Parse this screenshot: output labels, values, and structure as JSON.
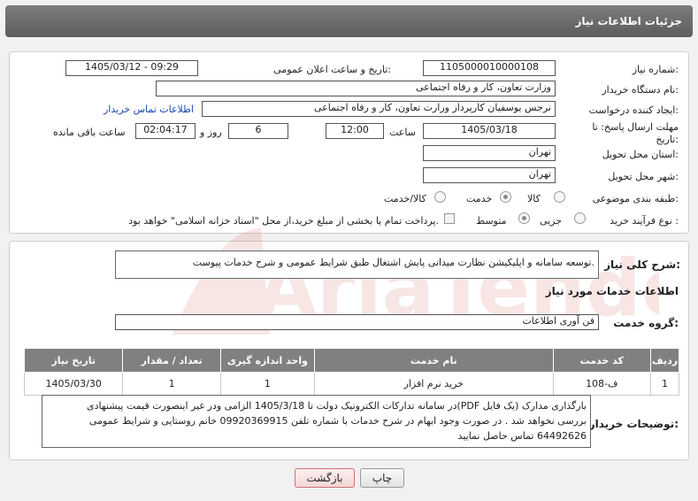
{
  "header": {
    "title": "جزئیات اطلاعات نیاز"
  },
  "form": {
    "need_number_label": "شماره نیاز:",
    "need_number": "1105000010000108",
    "announce_label": "تاریخ و ساعت اعلان عمومی:",
    "announce_value": "1405/03/12 - 09:29",
    "buyer_label": "نام دستگاه خریدار:",
    "buyer_value": "وزارت تعاون، کار و رفاه اجتماعی",
    "creator_label": "ایجاد کننده درخواست:",
    "creator_value": "نرجس یوسفیان کارپرداز وزارت تعاون، کار و رفاه اجتماعی",
    "contact_link": "اطلاعات تماس خریدار",
    "deadline_label": "مهلت ارسال پاسخ: تا تاریخ:",
    "deadline_date": "1405/03/18",
    "time_label": "ساعت",
    "deadline_time": "12:00",
    "days_value": "6",
    "days_label": "روز و",
    "remaining_time": "02:04:17",
    "remaining_label": "ساعت باقی مانده",
    "province_label": "استان محل تحویل:",
    "province_value": "تهران",
    "city_label": "شهر محل تحویل:",
    "city_value": "تهران",
    "category_label": "طبقه بندی موضوعی:",
    "category_options": [
      "کالا",
      "خدمت",
      "کالا/خدمت"
    ],
    "category_selected_index": 1,
    "process_label": "نوع فرآیند خرید :",
    "process_options": [
      "جزیی",
      "متوسط"
    ],
    "process_selected_index": 0,
    "payment_note": "پرداخت تمام یا بخشی از مبلغ خرید،از محل \"اسناد خزانه اسلامی\" خواهد بود."
  },
  "summary": {
    "label": "شرح کلی نیاز:",
    "value": "توسعه سامانه و اپلیکیشن نظارت میدانی پایش اشتغال طبق شرایط عمومی و شرح خدمات پیوست."
  },
  "services": {
    "section_title": "اطلاعات خدمات مورد نیاز",
    "group_label": "گروه خدمت:",
    "group_value": "فن آوری اطلاعات",
    "table": {
      "headers": [
        "ردیف",
        "کد خدمت",
        "نام خدمت",
        "واحد اندازه گیری",
        "تعداد / مقدار",
        "تاریخ نیاز"
      ],
      "rows": [
        [
          "1",
          "ف-108",
          "خرید نرم افزار",
          "1",
          "1",
          "1405/03/30"
        ]
      ]
    }
  },
  "buyer_notes": {
    "label": "توضیحات خریدار:",
    "lines": [
      "بارگذاری مدارک (یک فایل PDF)در سامانه تدارکات الکترونیک دولت تا 1405/3/18  الزامی ودر غیر اینصورت قیمت پیشنهادی",
      "بررسی نخواهد شد . در صورت وجود ابهام در شرح خدمات با شماره تلفن 09920369915 خانم روستایی و شرایط عمومی",
      "64492626 تماس حاصل نمایید"
    ]
  },
  "buttons": {
    "print": "چاپ",
    "back": "بازگشت"
  },
  "watermark": {
    "text": "AriaTender.net"
  },
  "colors": {
    "header_bg": "#6b6b6b",
    "table_header_bg": "#808080",
    "link": "#1a44b4",
    "back_button_border": "#d07070",
    "watermark": "#c0392b"
  }
}
